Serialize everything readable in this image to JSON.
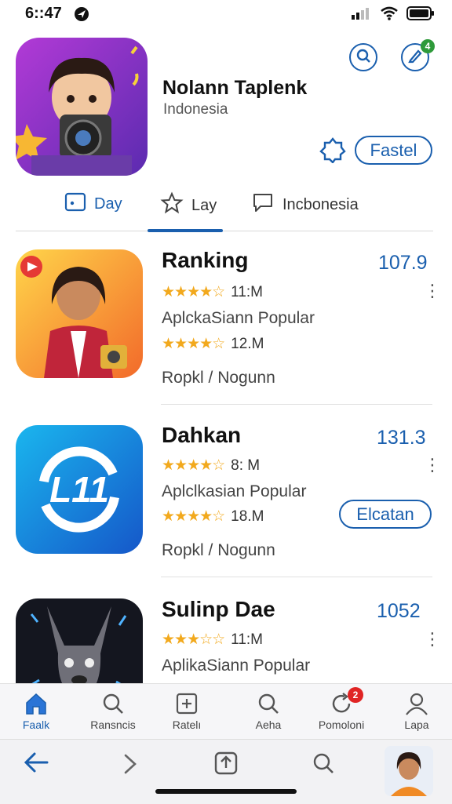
{
  "status": {
    "time": "6::47"
  },
  "header": {
    "title": "Nolann Taplenk",
    "subtitle": "Indonesia",
    "search_icon": "search-icon",
    "edit_icon": "pen-icon",
    "edit_badge": "4",
    "favorite_icon": "badge-star-icon",
    "action_label": "Fastel"
  },
  "tabs": [
    {
      "label": "Day",
      "icon": "calendar-icon"
    },
    {
      "label": "Lay",
      "icon": "star-outline-icon"
    },
    {
      "label": "Incbonesia",
      "icon": "chat-bubble-icon"
    }
  ],
  "apps": [
    {
      "name": "Ranking",
      "score": "107.9",
      "rating1": "11:M",
      "category": "AplckaSiann Popular",
      "rating2": "12.M",
      "footer": "Ropkl / Nogunn",
      "stars1": 4.5,
      "stars2": 4.5
    },
    {
      "name": "Dahkan",
      "score": "131.3",
      "rating1": "8: M",
      "category": "Aplclkasian Popular",
      "rating2": "18.M",
      "footer": "Ropkl / Nogunn",
      "action": "Elcatan",
      "logo_text": "L11",
      "stars1": 4,
      "stars2": 4
    },
    {
      "name": "Sulinp Dae",
      "score": "1052",
      "rating1": "11:M",
      "category": "AplikaSiann Popular",
      "stars1": 3
    }
  ],
  "bottom_nav": [
    {
      "label": "Faalk",
      "icon": "home-icon"
    },
    {
      "label": "Ransncis",
      "icon": "search-icon"
    },
    {
      "label": "Ratelı",
      "icon": "add-box-icon"
    },
    {
      "label": "Aeha",
      "icon": "search-icon"
    },
    {
      "label": "Pomoloni",
      "icon": "refresh-icon",
      "badge": "2"
    },
    {
      "label": "Lapa",
      "icon": "person-icon"
    }
  ],
  "colors": {
    "accent": "#1a5fae",
    "star": "#f2a91d",
    "badge": "#e02424"
  }
}
